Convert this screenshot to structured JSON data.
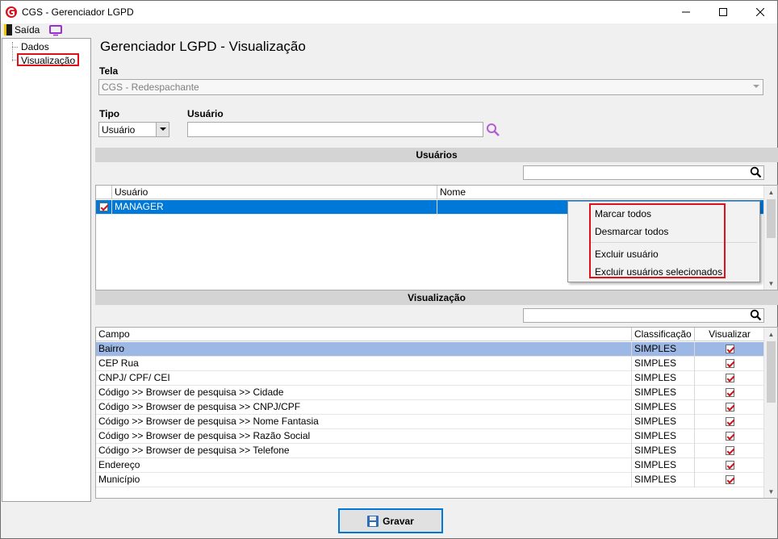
{
  "window": {
    "title": "CGS - Gerenciador LGPD"
  },
  "menubar": {
    "exit_label": "Saída"
  },
  "tree": {
    "items": [
      {
        "label": "Dados"
      },
      {
        "label": "Visualização"
      }
    ]
  },
  "heading": "Gerenciador LGPD - Visualização",
  "tela": {
    "label": "Tela",
    "value": "CGS - Redespachante"
  },
  "tipo": {
    "label": "Tipo",
    "value": "Usuário"
  },
  "usuario": {
    "label": "Usuário",
    "value": ""
  },
  "users_section": {
    "title": "Usuários",
    "search_value": "",
    "columns": [
      "Usuário",
      "Nome"
    ],
    "rows": [
      {
        "checked": true,
        "usuario": "MANAGER",
        "nome": ""
      }
    ]
  },
  "context_menu": {
    "items": [
      "Marcar todos",
      "Desmarcar todos",
      "Excluir usuário",
      "Excluir usuários selecionados"
    ]
  },
  "view_section": {
    "title": "Visualização",
    "search_value": "",
    "columns": [
      "Campo",
      "Classificação",
      "Visualizar"
    ],
    "rows": [
      {
        "campo": "Bairro",
        "classificacao": "SIMPLES",
        "visualizar": true
      },
      {
        "campo": "CEP Rua",
        "classificacao": "SIMPLES",
        "visualizar": true
      },
      {
        "campo": "CNPJ/ CPF/ CEI",
        "classificacao": "SIMPLES",
        "visualizar": true
      },
      {
        "campo": "Código >> Browser de pesquisa >> Cidade",
        "classificacao": "SIMPLES",
        "visualizar": true
      },
      {
        "campo": "Código >> Browser de pesquisa >> CNPJ/CPF",
        "classificacao": "SIMPLES",
        "visualizar": true
      },
      {
        "campo": "Código >> Browser de pesquisa >> Nome Fantasia",
        "classificacao": "SIMPLES",
        "visualizar": true
      },
      {
        "campo": "Código >> Browser de pesquisa >> Razão Social",
        "classificacao": "SIMPLES",
        "visualizar": true
      },
      {
        "campo": "Código >> Browser de pesquisa >> Telefone",
        "classificacao": "SIMPLES",
        "visualizar": true
      },
      {
        "campo": "Endereço",
        "classificacao": "SIMPLES",
        "visualizar": true
      },
      {
        "campo": "Município",
        "classificacao": "SIMPLES",
        "visualizar": true
      }
    ]
  },
  "save_button": {
    "label": "Gravar"
  },
  "colors": {
    "accent_red": "#e0101a",
    "selection_blue": "#0078d7",
    "selected_row": "#9db8e4",
    "icon_purple": "#9b30d0"
  }
}
